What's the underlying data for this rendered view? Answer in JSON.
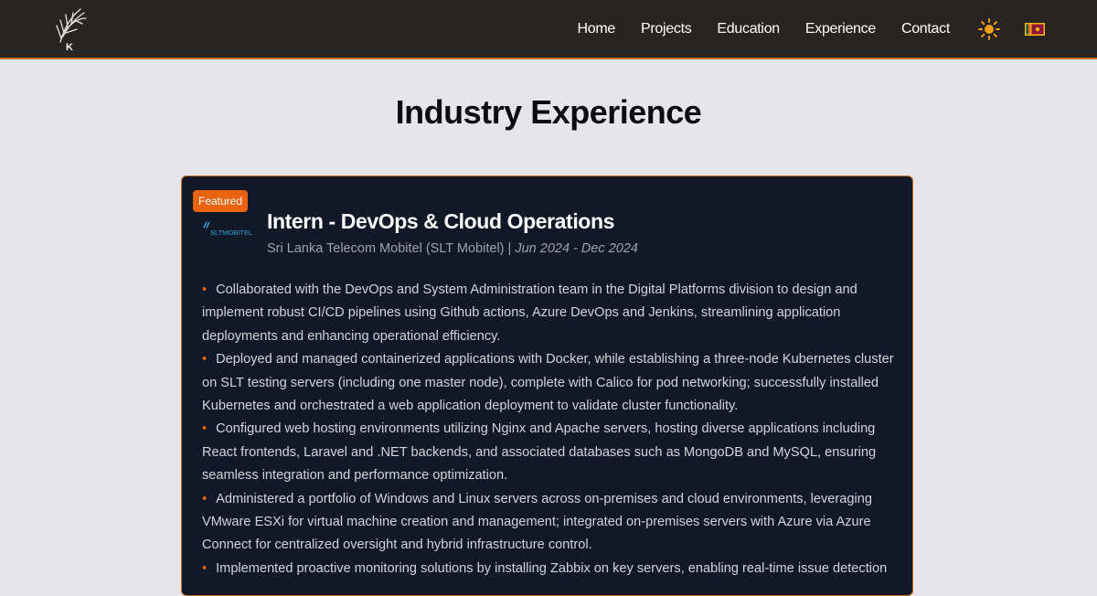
{
  "nav": {
    "links": [
      "Home",
      "Projects",
      "Education",
      "Experience",
      "Contact"
    ],
    "theme_icon": "sun-icon",
    "lang_icon": "sri-lanka-flag-icon"
  },
  "page": {
    "title": "Industry Experience"
  },
  "experience": {
    "badge": "Featured",
    "title": "Intern - DevOps & Cloud Operations",
    "company": "Sri Lanka Telecom Mobitel (SLT Mobitel)",
    "separator": "|",
    "dates": "Jun 2024 - Dec 2024",
    "logo_text": "SLTMOBITEL",
    "bullets": [
      "Collaborated with the DevOps and System Administration team in the Digital Platforms division to design and implement robust CI/CD pipelines using Github actions, Azure DevOps and Jenkins, streamlining application deployments and enhancing operational efficiency.",
      "Deployed and managed containerized applications with Docker, while establishing a three-node Kubernetes cluster on SLT testing servers (including one master node), complete with Calico for pod networking; successfully installed Kubernetes and orchestrated a web application deployment to validate cluster functionality.",
      "Configured web hosting environments utilizing Nginx and Apache servers, hosting diverse applications including React frontends, Laravel and .NET backends, and associated databases such as MongoDB and MySQL, ensuring seamless integration and performance optimization.",
      "Administered a portfolio of Windows and Linux servers across on-premises and cloud environments, leveraging VMware ESXi for virtual machine creation and management; integrated on-premises servers with Azure via Azure Connect for centralized oversight and hybrid infrastructure control.",
      "Implemented proactive monitoring solutions by installing Zabbix on key servers, enabling real-time issue detection"
    ]
  },
  "colors": {
    "accent": "#e8630f",
    "nav_bg": "#282422",
    "card_bg": "#111827",
    "page_bg": "#e6e6e9"
  }
}
